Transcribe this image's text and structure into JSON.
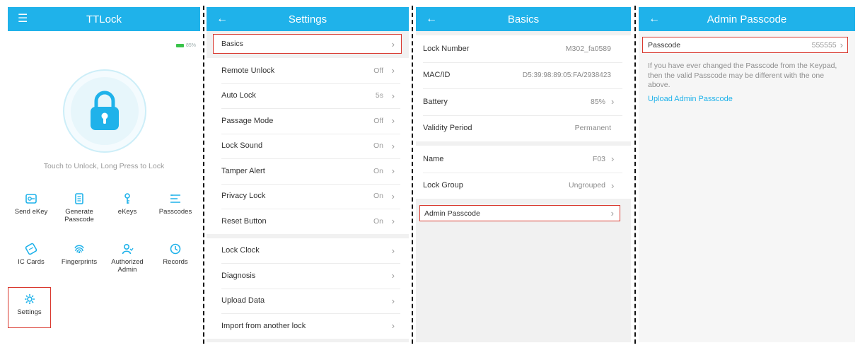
{
  "home": {
    "title": "TTLock",
    "battery_text": "85%",
    "touch_hint": "Touch to Unlock, Long Press to Lock",
    "grid": [
      {
        "label": "Send eKey",
        "icon": "send-ekey-icon"
      },
      {
        "label": "Generate Passcode",
        "icon": "generate-passcode-icon"
      },
      {
        "label": "eKeys",
        "icon": "ekeys-icon"
      },
      {
        "label": "Passcodes",
        "icon": "passcodes-icon"
      },
      {
        "label": "IC Cards",
        "icon": "ic-cards-icon"
      },
      {
        "label": "Fingerprints",
        "icon": "fingerprint-icon"
      },
      {
        "label": "Authorized Admin",
        "icon": "authorized-admin-icon"
      },
      {
        "label": "Records",
        "icon": "records-icon"
      },
      {
        "label": "Settings",
        "icon": "settings-gear-icon"
      }
    ]
  },
  "settings": {
    "title": "Settings",
    "basics_label": "Basics",
    "group1": [
      {
        "label": "Remote Unlock",
        "value": "Off"
      },
      {
        "label": "Auto Lock",
        "value": "5s"
      },
      {
        "label": "Passage Mode",
        "value": "Off"
      },
      {
        "label": "Lock Sound",
        "value": "On"
      },
      {
        "label": "Tamper Alert",
        "value": "On"
      },
      {
        "label": "Privacy Lock",
        "value": "On"
      },
      {
        "label": "Reset Button",
        "value": "On"
      }
    ],
    "group2": [
      {
        "label": "Lock Clock"
      },
      {
        "label": "Diagnosis"
      },
      {
        "label": "Upload Data"
      },
      {
        "label": "Import from another lock"
      }
    ]
  },
  "basics": {
    "title": "Basics",
    "group1": [
      {
        "label": "Lock Number",
        "value": "M302_fa0589",
        "chevron": false
      },
      {
        "label": "MAC/ID",
        "value": "D5:39:98:89:05:FA/2938423",
        "chevron": false
      },
      {
        "label": "Battery",
        "value": "85%",
        "chevron": true
      },
      {
        "label": "Validity Period",
        "value": "Permanent",
        "chevron": false
      }
    ],
    "group2": [
      {
        "label": "Name",
        "value": "F03",
        "chevron": true
      },
      {
        "label": "Lock Group",
        "value": "Ungrouped",
        "chevron": true
      }
    ],
    "admin_passcode_label": "Admin Passcode"
  },
  "admin_passcode": {
    "title": "Admin Passcode",
    "passcode_label": "Passcode",
    "passcode_value": "555555",
    "note": "If you have ever changed the Passcode from the Keypad, then the valid Passcode may be different with the one above.",
    "upload_link": "Upload Admin Passcode"
  },
  "colors": {
    "accent": "#1fb2ea",
    "highlight_border": "#d9382e",
    "battery_green": "#39c34a"
  }
}
